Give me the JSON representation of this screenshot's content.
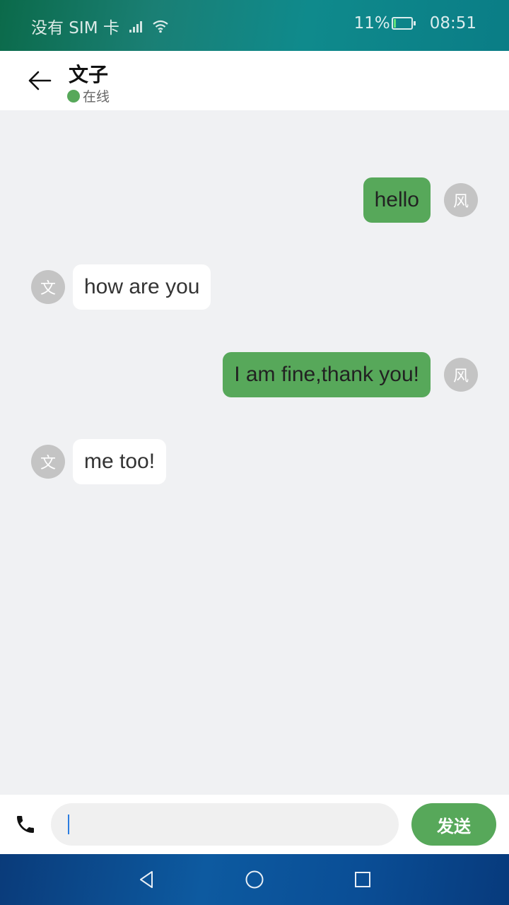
{
  "status_bar": {
    "carrier": "没有 SIM 卡",
    "battery": "11%",
    "time": "08:51",
    "battery_level": 0.11
  },
  "header": {
    "contact_name": "文子",
    "status": "在线",
    "status_color": "#57a85a"
  },
  "messages": [
    {
      "direction": "out",
      "avatar": "风",
      "text": "hello"
    },
    {
      "direction": "in",
      "avatar": "文",
      "text": "how are you"
    },
    {
      "direction": "out",
      "avatar": "风",
      "text": "I am fine,thank you!"
    },
    {
      "direction": "in",
      "avatar": "文",
      "text": "me too!"
    }
  ],
  "input": {
    "value": "",
    "send_label": "发送"
  },
  "colors": {
    "accent": "#57a85a",
    "background": "#f0f1f3",
    "avatar": "#c4c4c4"
  },
  "icons": {
    "back": "arrow-left-icon",
    "call": "phone-icon",
    "nav_back": "triangle-back-icon",
    "nav_home": "circle-home-icon",
    "nav_recent": "square-recent-icon"
  }
}
